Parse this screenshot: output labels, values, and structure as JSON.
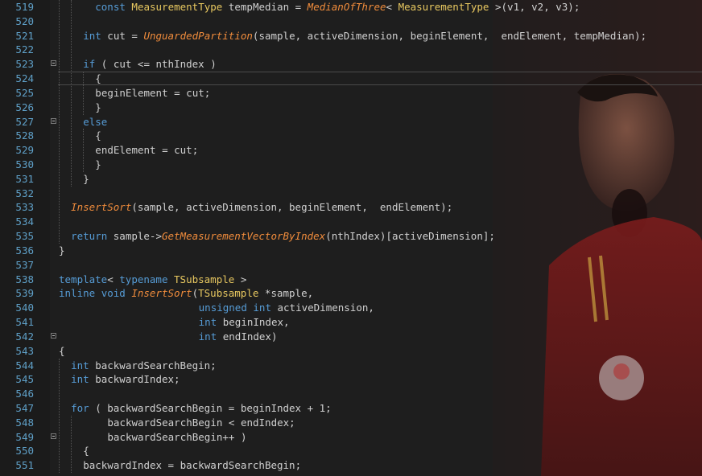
{
  "editor": {
    "lines": [
      {
        "n": "519",
        "fold": false,
        "tokens": [
          [
            "ws",
            "  "
          ],
          [
            "kw",
            "const"
          ],
          [
            "tx",
            " "
          ],
          [
            "ty",
            "MeasurementType"
          ],
          [
            "tx",
            " tempMedian = "
          ],
          [
            "fn",
            "MedianOfThree"
          ],
          [
            "tx",
            "< "
          ],
          [
            "ty",
            "MeasurementType"
          ],
          [
            "tx",
            " >(v1, v2, v3);"
          ]
        ],
        "indent": 4
      },
      {
        "n": "520",
        "fold": false,
        "tokens": [],
        "indent": 0
      },
      {
        "n": "521",
        "fold": false,
        "tokens": [
          [
            "kw",
            "int"
          ],
          [
            "tx",
            " cut = "
          ],
          [
            "fn",
            "UnguardedPartition"
          ],
          [
            "tx",
            "(sample, activeDimension, beginElement,  endElement, tempMedian);"
          ]
        ],
        "indent": 4
      },
      {
        "n": "522",
        "fold": false,
        "tokens": [],
        "indent": 0
      },
      {
        "n": "523",
        "fold": true,
        "tokens": [
          [
            "kw",
            "if"
          ],
          [
            "tx",
            " ( cut <= nthIndex )"
          ]
        ],
        "indent": 4
      },
      {
        "n": "524",
        "fold": false,
        "tokens": [
          [
            "tx",
            "{"
          ]
        ],
        "indent": 6
      },
      {
        "n": "525",
        "fold": false,
        "tokens": [
          [
            "tx",
            "beginElement = cut;"
          ]
        ],
        "indent": 6
      },
      {
        "n": "526",
        "fold": false,
        "tokens": [
          [
            "tx",
            "}"
          ]
        ],
        "indent": 6
      },
      {
        "n": "527",
        "fold": true,
        "tokens": [
          [
            "kw",
            "else"
          ]
        ],
        "indent": 4
      },
      {
        "n": "528",
        "fold": false,
        "tokens": [
          [
            "tx",
            "{"
          ]
        ],
        "indent": 6
      },
      {
        "n": "529",
        "fold": false,
        "tokens": [
          [
            "tx",
            "endElement = cut;"
          ]
        ],
        "indent": 6
      },
      {
        "n": "530",
        "fold": false,
        "tokens": [
          [
            "tx",
            "}"
          ]
        ],
        "indent": 6
      },
      {
        "n": "531",
        "fold": false,
        "tokens": [
          [
            "tx",
            "}"
          ]
        ],
        "indent": 4
      },
      {
        "n": "532",
        "fold": false,
        "tokens": [],
        "indent": 0
      },
      {
        "n": "533",
        "fold": false,
        "tokens": [
          [
            "fn",
            "InsertSort"
          ],
          [
            "tx",
            "(sample, activeDimension, beginElement,  endElement);"
          ]
        ],
        "indent": 2
      },
      {
        "n": "534",
        "fold": false,
        "tokens": [],
        "indent": 0
      },
      {
        "n": "535",
        "fold": false,
        "tokens": [
          [
            "kw",
            "return"
          ],
          [
            "tx",
            " sample->"
          ],
          [
            "fn",
            "GetMeasurementVectorByIndex"
          ],
          [
            "tx",
            "(nthIndex)[activeDimension];"
          ]
        ],
        "indent": 2
      },
      {
        "n": "536",
        "fold": false,
        "tokens": [
          [
            "tx",
            "}"
          ]
        ],
        "indent": 0
      },
      {
        "n": "537",
        "fold": false,
        "tokens": [],
        "indent": 0
      },
      {
        "n": "538",
        "fold": false,
        "tokens": [
          [
            "kw",
            "template"
          ],
          [
            "tx",
            "< "
          ],
          [
            "kw",
            "typename"
          ],
          [
            "tx",
            " "
          ],
          [
            "ty",
            "TSubsample"
          ],
          [
            "tx",
            " >"
          ]
        ],
        "indent": 0
      },
      {
        "n": "539",
        "fold": false,
        "tokens": [
          [
            "kw",
            "inline"
          ],
          [
            "tx",
            " "
          ],
          [
            "kw",
            "void"
          ],
          [
            "tx",
            " "
          ],
          [
            "fn",
            "InsertSort"
          ],
          [
            "tx",
            "("
          ],
          [
            "ty",
            "TSubsample"
          ],
          [
            "tx",
            " *sample,"
          ]
        ],
        "indent": 0
      },
      {
        "n": "540",
        "fold": false,
        "tokens": [
          [
            "kw",
            "unsigned"
          ],
          [
            "tx",
            " "
          ],
          [
            "kw",
            "int"
          ],
          [
            "tx",
            " activeDimension,"
          ]
        ],
        "indent": 23
      },
      {
        "n": "541",
        "fold": false,
        "tokens": [
          [
            "kw",
            "int"
          ],
          [
            "tx",
            " beginIndex,"
          ]
        ],
        "indent": 23
      },
      {
        "n": "542",
        "fold": true,
        "tokens": [
          [
            "kw",
            "int"
          ],
          [
            "tx",
            " endIndex)"
          ]
        ],
        "indent": 23
      },
      {
        "n": "543",
        "fold": false,
        "tokens": [
          [
            "tx",
            "{"
          ]
        ],
        "indent": 0
      },
      {
        "n": "544",
        "fold": false,
        "tokens": [
          [
            "kw",
            "int"
          ],
          [
            "tx",
            " backwardSearchBegin;"
          ]
        ],
        "indent": 2
      },
      {
        "n": "545",
        "fold": false,
        "tokens": [
          [
            "kw",
            "int"
          ],
          [
            "tx",
            " backwardIndex;"
          ]
        ],
        "indent": 2
      },
      {
        "n": "546",
        "fold": false,
        "tokens": [],
        "indent": 0
      },
      {
        "n": "547",
        "fold": false,
        "tokens": [
          [
            "kw",
            "for"
          ],
          [
            "tx",
            " ( backwardSearchBegin = beginIndex + 1;"
          ]
        ],
        "indent": 2
      },
      {
        "n": "548",
        "fold": false,
        "tokens": [
          [
            "tx",
            "backwardSearchBegin < endIndex;"
          ]
        ],
        "indent": 8
      },
      {
        "n": "549",
        "fold": true,
        "tokens": [
          [
            "tx",
            "backwardSearchBegin++ )"
          ]
        ],
        "indent": 8
      },
      {
        "n": "550",
        "fold": false,
        "tokens": [
          [
            "tx",
            "{"
          ]
        ],
        "indent": 4
      },
      {
        "n": "551",
        "fold": false,
        "tokens": [
          [
            "tx",
            "backwardIndex = backwardSearchBegin;"
          ]
        ],
        "indent": 4
      }
    ]
  }
}
